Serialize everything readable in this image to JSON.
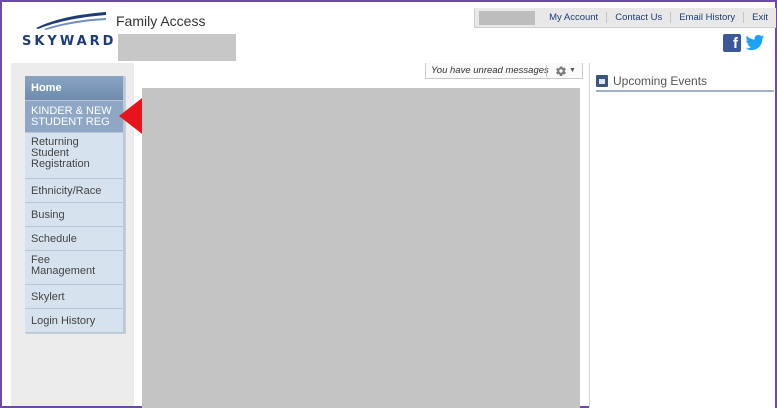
{
  "app": {
    "title": "Family Access",
    "logo_text": "SKYWARD"
  },
  "topbar": {
    "links": [
      "My Account",
      "Contact Us",
      "Email History",
      "Exit"
    ]
  },
  "social": {
    "facebook_glyph": "f"
  },
  "sidebar": {
    "items": [
      {
        "label": "Home"
      },
      {
        "label": "KINDER & NEW STUDENT REG"
      },
      {
        "label": "Returning Student Registration"
      },
      {
        "label": "Ethnicity/Race"
      },
      {
        "label": "Busing"
      },
      {
        "label": "Schedule"
      },
      {
        "label": "Fee Management"
      },
      {
        "label": "Skylert"
      },
      {
        "label": "Login History"
      }
    ]
  },
  "messages": {
    "text": "You have unread messages"
  },
  "events": {
    "title": "Upcoming Events"
  },
  "colors": {
    "frame": "#6b4aa8",
    "brand_blue": "#1d3d78",
    "nav_selected": "#8ea7c4",
    "arrow": "#e8141c"
  },
  "icons": [
    "gear-icon",
    "chevron-down-icon",
    "calendar-icon",
    "facebook-icon",
    "twitter-icon"
  ]
}
